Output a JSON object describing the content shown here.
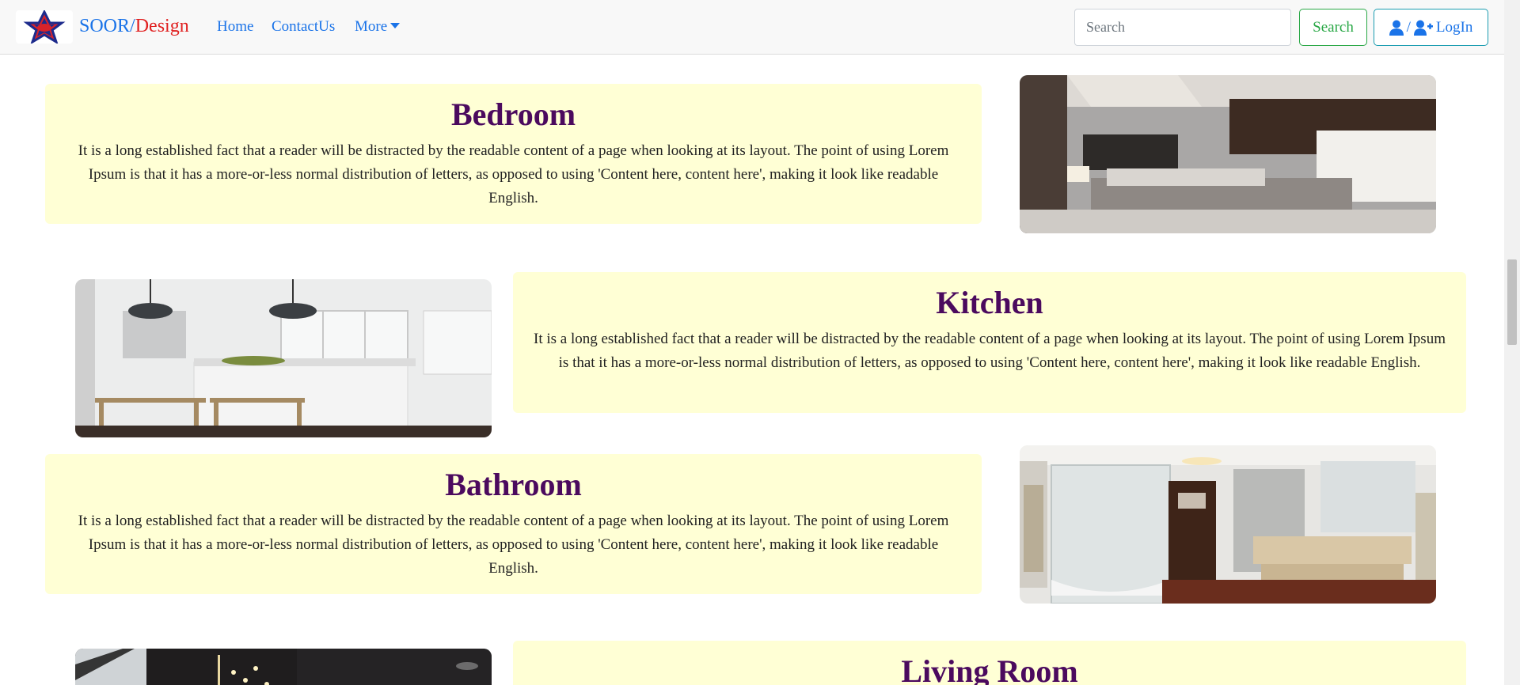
{
  "navbar": {
    "brand_part1": "SOOR",
    "brand_sep": "/",
    "brand_part2": "Design",
    "links": [
      "Home",
      "ContactUs",
      "More"
    ],
    "search_placeholder": "Search",
    "search_button": "Search",
    "login_sep": "/",
    "login_label": "LogIn"
  },
  "sections": [
    {
      "title": "Bedroom",
      "text": "It is a long established fact that a reader will be distracted by the readable content of a page when looking at its layout. The point of using Lorem Ipsum is that it has a more-or-less normal distribution of letters, as opposed to using 'Content here, content here', making it look like readable English."
    },
    {
      "title": "Kitchen",
      "text": "It is a long established fact that a reader will be distracted by the readable content of a page when looking at its layout. The point of using Lorem Ipsum is that it has a more-or-less normal distribution of letters, as opposed to using 'Content here, content here', making it look like readable English."
    },
    {
      "title": "Bathroom",
      "text": "It is a long established fact that a reader will be distracted by the readable content of a page when looking at its layout. The point of using Lorem Ipsum is that it has a more-or-less normal distribution of letters, as opposed to using 'Content here, content here', making it look like readable English."
    },
    {
      "title": "Living Room",
      "text": ""
    }
  ],
  "icons": [
    "star-logo-icon",
    "user-icon",
    "user-plus-icon",
    "chevron-down-icon"
  ],
  "colors": {
    "brand_blue": "#1a73e8",
    "brand_red": "#e02020",
    "heading_purple": "#4b0a5e",
    "panel_bg": "#ffffd5",
    "success_green": "#28a745"
  }
}
